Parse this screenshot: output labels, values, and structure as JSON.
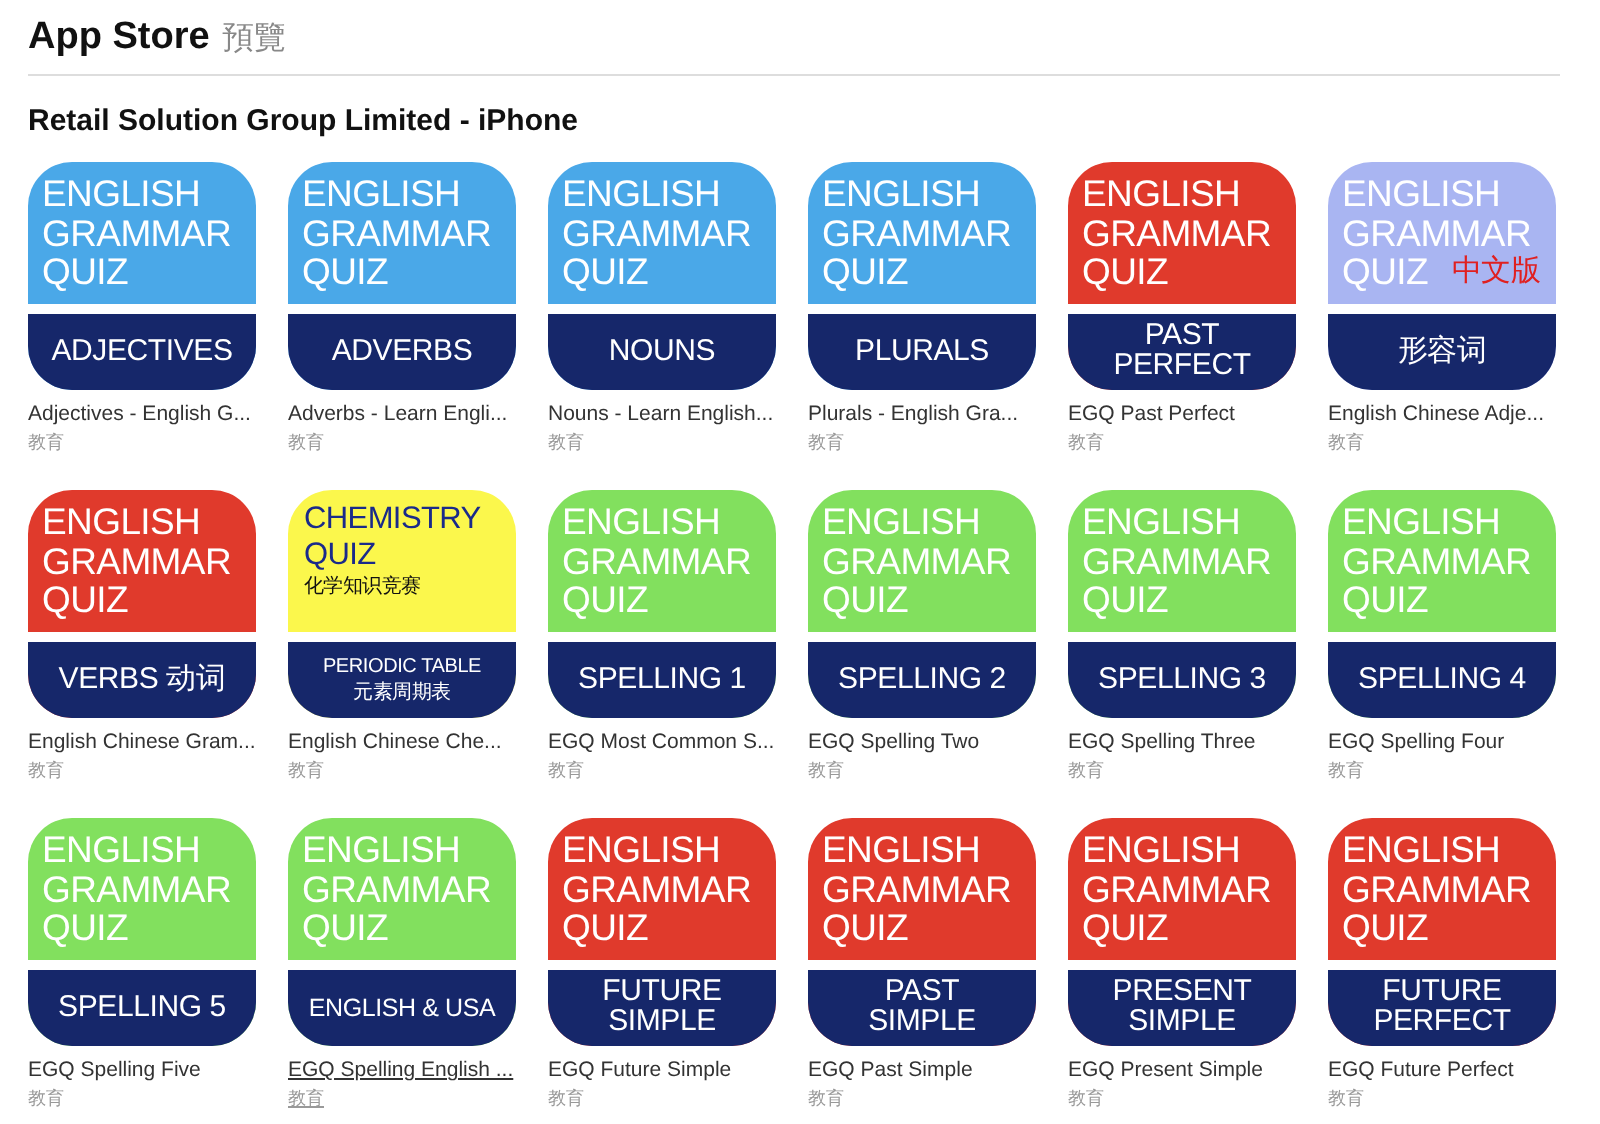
{
  "header": {
    "title": "App Store",
    "subtitle": "預覽"
  },
  "section": {
    "title": "Retail Solution Group Limited - iPhone"
  },
  "apps": [
    {
      "kind": "grammar",
      "color": "#4aa8e8",
      "title": [
        "ENGLISH",
        "GRAMMAR",
        "QUIZ"
      ],
      "label": [
        "ADJECTIVES"
      ],
      "name": "Adjectives - English G...",
      "category": "教育",
      "hovered": false
    },
    {
      "kind": "grammar",
      "color": "#4aa8e8",
      "title": [
        "ENGLISH",
        "GRAMMAR",
        "QUIZ"
      ],
      "label": [
        "ADVERBS"
      ],
      "name": "Adverbs - Learn Engli...",
      "category": "教育",
      "hovered": false
    },
    {
      "kind": "grammar",
      "color": "#4aa8e8",
      "title": [
        "ENGLISH",
        "GRAMMAR",
        "QUIZ"
      ],
      "label": [
        "NOUNS"
      ],
      "name": "Nouns - Learn English...",
      "category": "教育",
      "hovered": false
    },
    {
      "kind": "grammar",
      "color": "#4aa8e8",
      "title": [
        "ENGLISH",
        "GRAMMAR",
        "QUIZ"
      ],
      "label": [
        "PLURALS"
      ],
      "name": "Plurals - English Gra...",
      "category": "教育",
      "hovered": false
    },
    {
      "kind": "grammar",
      "color": "#e03a2c",
      "title": [
        "ENGLISH",
        "GRAMMAR",
        "QUIZ"
      ],
      "label": [
        "PAST",
        "PERFECT"
      ],
      "name": "EGQ Past Perfect",
      "category": "教育",
      "hovered": false
    },
    {
      "kind": "grammar",
      "color": "#a9b5f2",
      "title": [
        "ENGLISH",
        "GRAMMAR",
        "QUIZ"
      ],
      "note": "中文版",
      "label": [
        "形容词"
      ],
      "name": "English Chinese Adje...",
      "category": "教育",
      "hovered": false
    },
    {
      "kind": "grammar",
      "color": "#e03a2c",
      "title": [
        "ENGLISH",
        "GRAMMAR",
        "QUIZ"
      ],
      "label": [
        "VERBS 动词"
      ],
      "name": "English Chinese Gram...",
      "category": "教育",
      "hovered": false
    },
    {
      "kind": "chemistry",
      "color": "#fbf74c",
      "title": [
        "CHEMISTRY",
        "QUIZ"
      ],
      "note": "化学知识竞赛",
      "label": [
        "PERIODIC TABLE",
        "元素周期表"
      ],
      "name": "English Chinese Che...",
      "category": "教育",
      "hovered": false
    },
    {
      "kind": "grammar",
      "color": "#82e05e",
      "title": [
        "ENGLISH",
        "GRAMMAR",
        "QUIZ"
      ],
      "label": [
        "SPELLING 1"
      ],
      "name": "EGQ Most Common S...",
      "category": "教育",
      "hovered": false
    },
    {
      "kind": "grammar",
      "color": "#82e05e",
      "title": [
        "ENGLISH",
        "GRAMMAR",
        "QUIZ"
      ],
      "label": [
        "SPELLING 2"
      ],
      "name": "EGQ Spelling Two",
      "category": "教育",
      "hovered": false
    },
    {
      "kind": "grammar",
      "color": "#82e05e",
      "title": [
        "ENGLISH",
        "GRAMMAR",
        "QUIZ"
      ],
      "label": [
        "SPELLING 3"
      ],
      "name": "EGQ Spelling Three",
      "category": "教育",
      "hovered": false
    },
    {
      "kind": "grammar",
      "color": "#82e05e",
      "title": [
        "ENGLISH",
        "GRAMMAR",
        "QUIZ"
      ],
      "label": [
        "SPELLING 4"
      ],
      "name": "EGQ Spelling Four",
      "category": "教育",
      "hovered": false
    },
    {
      "kind": "grammar",
      "color": "#82e05e",
      "title": [
        "ENGLISH",
        "GRAMMAR",
        "QUIZ"
      ],
      "label": [
        "SPELLING 5"
      ],
      "name": "EGQ Spelling Five",
      "category": "教育",
      "hovered": false
    },
    {
      "kind": "grammar",
      "color": "#82e05e",
      "title": [
        "ENGLISH",
        "GRAMMAR",
        "QUIZ"
      ],
      "label": [
        "ENGLISH & USA"
      ],
      "name": "EGQ Spelling English ...",
      "category": "教育",
      "hovered": true
    },
    {
      "kind": "grammar",
      "color": "#e03a2c",
      "title": [
        "ENGLISH",
        "GRAMMAR",
        "QUIZ"
      ],
      "label": [
        "FUTURE",
        "SIMPLE"
      ],
      "name": "EGQ Future Simple",
      "category": "教育",
      "hovered": false
    },
    {
      "kind": "grammar",
      "color": "#e03a2c",
      "title": [
        "ENGLISH",
        "GRAMMAR",
        "QUIZ"
      ],
      "label": [
        "PAST",
        "SIMPLE"
      ],
      "name": "EGQ Past Simple",
      "category": "教育",
      "hovered": false
    },
    {
      "kind": "grammar",
      "color": "#e03a2c",
      "title": [
        "ENGLISH",
        "GRAMMAR",
        "QUIZ"
      ],
      "label": [
        "PRESENT",
        "SIMPLE"
      ],
      "name": "EGQ Present Simple",
      "category": "教育",
      "hovered": false
    },
    {
      "kind": "grammar",
      "color": "#e03a2c",
      "title": [
        "ENGLISH",
        "GRAMMAR",
        "QUIZ"
      ],
      "label": [
        "FUTURE",
        "PERFECT"
      ],
      "name": "EGQ Future Perfect",
      "category": "教育",
      "hovered": false
    }
  ]
}
